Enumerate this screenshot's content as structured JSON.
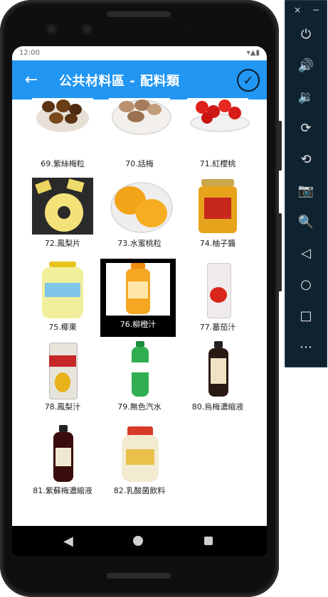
{
  "app": {
    "title": "公共材料區 - 配料類"
  },
  "statusbar": {
    "left": "12:00",
    "right": "▾▲▮"
  },
  "items": [
    {
      "label": "69.紫絲梅粒"
    },
    {
      "label": "70.話梅"
    },
    {
      "label": "71.紅櫻桃"
    },
    {
      "label": "72.鳳梨片"
    },
    {
      "label": "73.水蜜桃粒"
    },
    {
      "label": "74.柚子醬"
    },
    {
      "label": "75.椰果"
    },
    {
      "label": "76.柳橙汁"
    },
    {
      "label": "77.蕃茄汁"
    },
    {
      "label": "78.鳳梨汁"
    },
    {
      "label": "79.無色汽水"
    },
    {
      "label": "80.烏梅濃縮液"
    },
    {
      "label": "81.紫蘇梅濃縮液"
    },
    {
      "label": "82.乳酸菌飲料"
    }
  ],
  "selected_index": 7,
  "panel": {
    "close": "×",
    "minimize": "−",
    "buttons": [
      "⏻",
      "🔊",
      "🔉",
      "⟳",
      "⟲",
      "📷",
      "🔍",
      "◁",
      "○",
      "□",
      "⋯"
    ]
  },
  "colors": {
    "appbar": "#2196f3",
    "panel_bg": "#0f2230"
  }
}
